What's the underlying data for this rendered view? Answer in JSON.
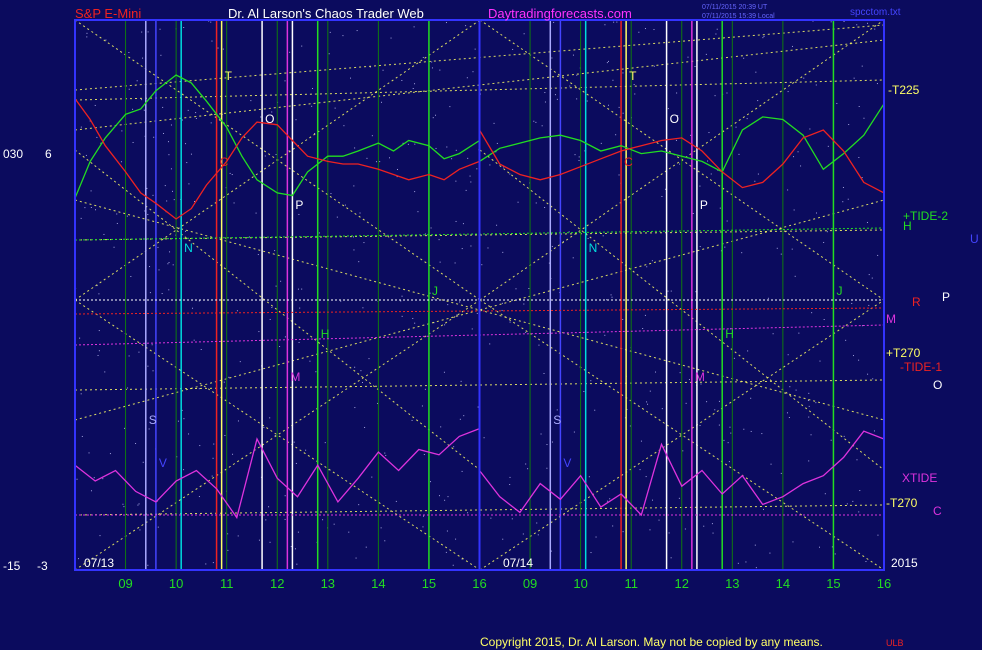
{
  "header": {
    "symbol": "S&P E-Mini",
    "title": "Dr. Al Larson's Chaos Trader Web",
    "site": "Daytradingforecasts.com",
    "stamp1": "07/11/2015 20:39 UT",
    "stamp2": "07/11/2015 15:39 Local",
    "file": "spcctom.txt"
  },
  "left_scale": {
    "top_a": "030",
    "top_b": "6",
    "bottom_a": "-15",
    "bottom_b": "-3"
  },
  "footer": {
    "copyright": "Copyright 2015, Dr. Al Larson. May not be copied by any means.",
    "tag": "ULB"
  },
  "day_labels": [
    "07/13",
    "07/14"
  ],
  "year_label": "2015",
  "chart_data": {
    "type": "line",
    "title": "S&P E-Mini",
    "x_ticks": [
      "09",
      "10",
      "11",
      "12",
      "13",
      "14",
      "15",
      "16",
      "09",
      "10",
      "11",
      "12",
      "13",
      "14",
      "15",
      "16"
    ],
    "x_tick_hours": [
      9,
      10,
      11,
      12,
      13,
      14,
      15,
      16,
      33,
      34,
      35,
      36,
      37,
      38,
      39,
      40
    ],
    "x_range_hours": [
      8,
      40
    ],
    "sessions": [
      {
        "label": "07/13",
        "start_hour": 8,
        "end_hour": 16
      },
      {
        "label": "07/14",
        "start_hour": 32,
        "end_hour": 40
      }
    ],
    "series": [
      {
        "name": "+TIDE-2",
        "color": "#22dd22",
        "x": [
          8,
          8.3,
          8.6,
          9,
          9.3,
          9.6,
          10,
          10.3,
          10.6,
          11,
          11.3,
          11.6,
          12,
          12.3,
          12.6,
          13,
          13.3,
          13.6,
          14,
          14.3,
          14.6,
          15,
          15.3,
          15.6,
          16,
          32,
          32.4,
          32.8,
          33.2,
          33.6,
          34,
          34.4,
          34.8,
          35.2,
          35.6,
          36,
          36.4,
          36.8,
          37.2,
          37.6,
          38,
          38.4,
          38.8,
          39.2,
          39.6,
          40
        ],
        "y": [
          -0.8,
          0.6,
          1.5,
          2.4,
          2.6,
          3.3,
          3.9,
          3.6,
          2.9,
          1.9,
          0.8,
          -0.1,
          -0.6,
          -0.7,
          0.2,
          0.8,
          0.8,
          1.0,
          1.3,
          1.0,
          1.4,
          1.2,
          0.7,
          0.9,
          1.4,
          0.6,
          1.1,
          1.3,
          1.5,
          1.6,
          1.4,
          1.0,
          1.2,
          0.9,
          1.0,
          0.8,
          0.6,
          0.2,
          1.8,
          2.3,
          2.2,
          1.6,
          0.3,
          0.9,
          1.6,
          2.8
        ]
      },
      {
        "name": "-TIDE-1",
        "color": "#ee2222",
        "x": [
          8,
          8.3,
          8.6,
          9,
          9.3,
          9.6,
          10,
          10.3,
          10.6,
          11,
          11.3,
          11.6,
          12,
          12.3,
          12.6,
          13,
          13.3,
          13.6,
          14,
          14.3,
          14.6,
          15,
          15.3,
          15.6,
          16,
          32,
          32.4,
          32.8,
          33.2,
          33.6,
          34,
          34.4,
          34.8,
          35.2,
          35.6,
          36,
          36.4,
          36.8,
          37.2,
          37.6,
          38,
          38.4,
          38.8,
          39.2,
          39.6,
          40
        ],
        "y": [
          3.0,
          2.2,
          1.2,
          0.2,
          -0.6,
          -1.0,
          -1.6,
          -1.2,
          -0.3,
          0.6,
          1.5,
          2.1,
          2.0,
          1.4,
          0.8,
          0.6,
          0.5,
          0.5,
          0.3,
          0.1,
          -0.1,
          0.1,
          -0.1,
          0.3,
          0.6,
          1.8,
          0.5,
          0.1,
          -0.1,
          0.1,
          0.4,
          0.7,
          1.0,
          1.2,
          1.4,
          1.5,
          1.0,
          0.2,
          -0.4,
          -0.2,
          0.5,
          1.5,
          1.8,
          1.0,
          -0.2,
          -0.6
        ]
      },
      {
        "name": "XTIDE",
        "color": "#dd33dd",
        "x": [
          8,
          8.4,
          8.8,
          9.2,
          9.6,
          10,
          10.4,
          10.8,
          11.2,
          11.6,
          12,
          12.4,
          12.8,
          13.2,
          13.6,
          14,
          14.4,
          14.8,
          15.2,
          15.6,
          16,
          32,
          32.4,
          32.8,
          33.2,
          33.6,
          34,
          34.4,
          34.8,
          35.2,
          35.6,
          36,
          36.4,
          36.8,
          37.2,
          37.6,
          38,
          38.4,
          38.8,
          39.2,
          39.6,
          40
        ],
        "y": [
          -11.0,
          -11.6,
          -11.2,
          -12.0,
          -12.4,
          -11.6,
          -11.2,
          -11.9,
          -13.0,
          -10.0,
          -11.5,
          -12.2,
          -11.0,
          -12.4,
          -11.5,
          -10.5,
          -11.2,
          -10.4,
          -10.6,
          -9.9,
          -9.6,
          -11.2,
          -12.2,
          -12.8,
          -11.7,
          -12.3,
          -11.4,
          -12.6,
          -12.1,
          -12.9,
          -10.2,
          -11.8,
          -11.2,
          -12.1,
          -11.4,
          -12.5,
          -12.2,
          -11.7,
          -11.4,
          -10.7,
          -9.7,
          -10.0
        ]
      }
    ],
    "timing_lines": [
      {
        "label": "T",
        "color": "#ffff66",
        "hour": 10.9
      },
      {
        "label": "O",
        "color": "#ffffff",
        "hour": 11.7
      },
      {
        "label": "C",
        "color": "#ee2222",
        "hour": 10.8
      },
      {
        "label": "P",
        "color": "#ffffff",
        "hour": 12.3
      },
      {
        "label": "N",
        "color": "#00dddd",
        "hour": 10.1
      },
      {
        "label": "J",
        "color": "#22dd22",
        "hour": 15.0
      },
      {
        "label": "H",
        "color": "#22dd22",
        "hour": 12.8
      },
      {
        "label": "M",
        "color": "#dd33dd",
        "hour": 12.2
      },
      {
        "label": "S",
        "color": "#aaaaff",
        "hour": 9.4
      },
      {
        "label": "V",
        "color": "#4444ff",
        "hour": 9.6
      }
    ],
    "right_labels": [
      {
        "text": "-T225",
        "color": "#ffff66"
      },
      {
        "text": "+TIDE-2",
        "color": "#22dd22"
      },
      {
        "text": "H",
        "color": "#22dd22"
      },
      {
        "text": "U",
        "color": "#4444ff"
      },
      {
        "text": "P",
        "color": "#ffffff"
      },
      {
        "text": "R",
        "color": "#ee2222"
      },
      {
        "text": "M",
        "color": "#dd33dd"
      },
      {
        "text": "+T270",
        "color": "#ffff66"
      },
      {
        "text": "-TIDE-1",
        "color": "#ee2222"
      },
      {
        "text": "O",
        "color": "#ffffff"
      },
      {
        "text": "XTIDE",
        "color": "#dd33dd"
      },
      {
        "text": "-T270",
        "color": "#ffff66"
      },
      {
        "text": "C",
        "color": "#dd33dd"
      }
    ],
    "ylim": [
      -15,
      6
    ],
    "grid": true
  },
  "colors": {
    "background": "#0b0b5e",
    "frame": "#3333ff",
    "tide2": "#22dd22",
    "tide1": "#ee2222",
    "xtide": "#dd33dd",
    "geometry": "#ffff66",
    "header_red": "#ee2222",
    "header_magenta": "#ff33ff"
  }
}
